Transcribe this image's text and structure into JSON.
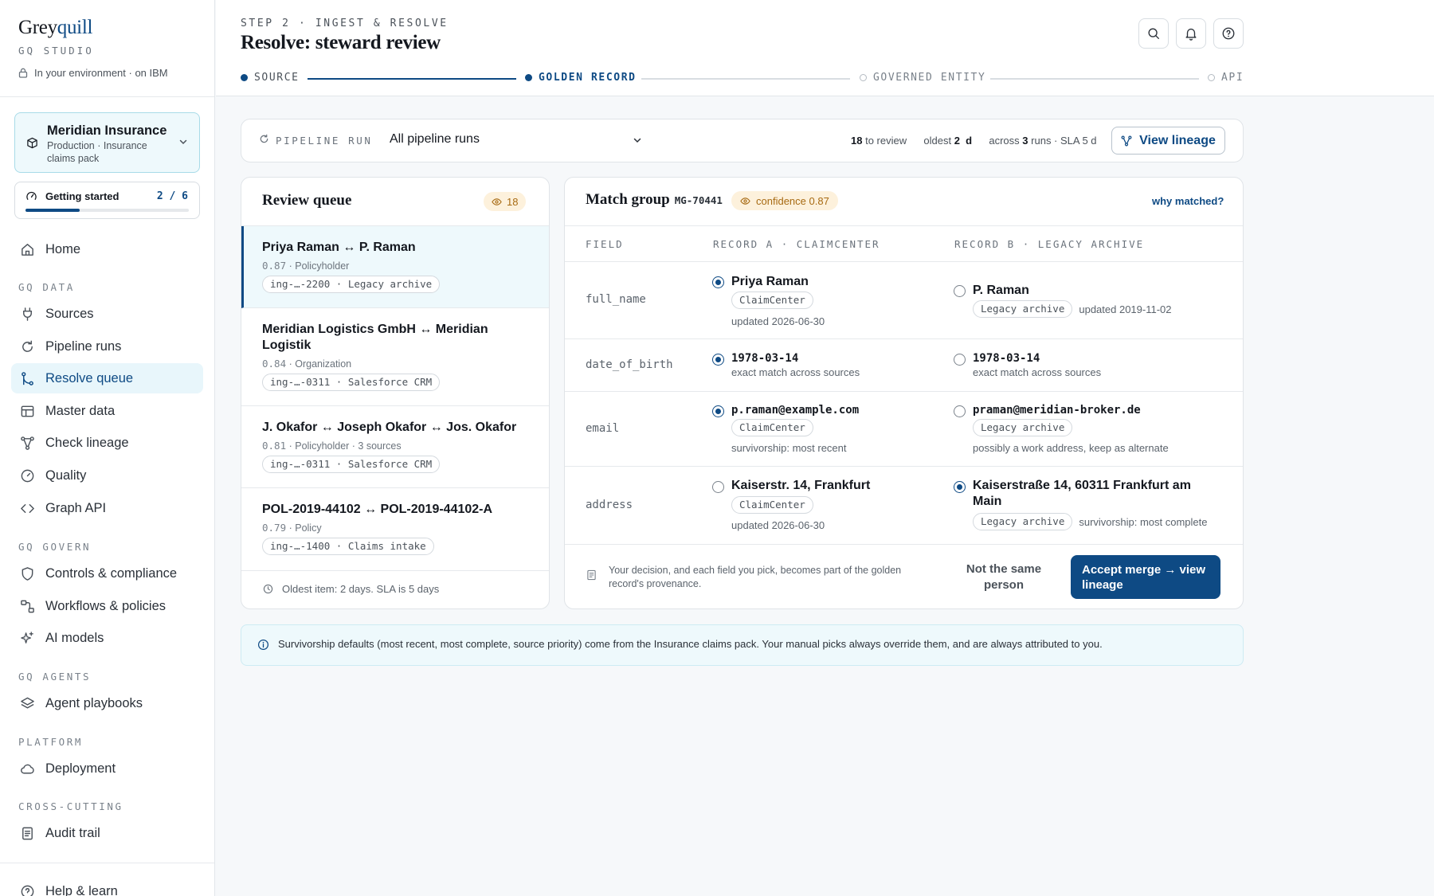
{
  "brand": {
    "name_a": "Grey",
    "name_b": "quill",
    "studio": "GQ STUDIO",
    "env": "In your environment · on IBM"
  },
  "workspace": {
    "name": "Meridian Insurance",
    "sub": "Production · Insurance claims pack"
  },
  "getting_started": {
    "label": "Getting started",
    "count": "2 / 6",
    "progress": 0.333
  },
  "nav": {
    "home": "Home",
    "sec_data": "GQ DATA",
    "sources": "Sources",
    "pipeline_runs": "Pipeline runs",
    "resolve_queue": "Resolve queue",
    "master_data": "Master data",
    "check_lineage": "Check lineage",
    "quality": "Quality",
    "graph_api": "Graph API",
    "sec_govern": "GQ GOVERN",
    "controls": "Controls & compliance",
    "workflows": "Workflows & policies",
    "ai_models": "AI models",
    "sec_agents": "GQ AGENTS",
    "agent_playbooks": "Agent playbooks",
    "sec_platform": "PLATFORM",
    "deployment": "Deployment",
    "sec_cross": "CROSS-CUTTING",
    "audit_trail": "Audit trail",
    "help": "Help & learn"
  },
  "header": {
    "kicker": "STEP 2 · INGEST & RESOLVE",
    "title": "Resolve: steward review",
    "steps": [
      "SOURCE",
      "GOLDEN RECORD",
      "GOVERNED ENTITY",
      "API"
    ]
  },
  "filter": {
    "label": "PIPELINE RUN",
    "value": "All pipeline runs",
    "to_review_num": "18",
    "to_review_txt": "to review",
    "oldest_txt": "oldest",
    "oldest_num": "2",
    "oldest_unit": "d",
    "across_txt": "across",
    "runs_num": "3",
    "runs_txt": "runs · SLA 5 d",
    "lineage_button": "View lineage"
  },
  "queue": {
    "title": "Review queue",
    "count": "18",
    "items": [
      {
        "title": "Priya Raman ↔ P. Raman",
        "score": "0.87",
        "meta": "· Policyholder",
        "pill": "ing-…-2200 · Legacy archive"
      },
      {
        "title": "Meridian Logistics GmbH ↔ Meridian Logistik",
        "score": "0.84",
        "meta": "· Organization",
        "pill": "ing-…-0311 · Salesforce CRM"
      },
      {
        "title": "J. Okafor ↔ Joseph Okafor ↔ Jos. Okafor",
        "score": "0.81",
        "meta": "· Policyholder · 3 sources",
        "pill": "ing-…-0311 · Salesforce CRM"
      },
      {
        "title": "POL-2019-44102 ↔ POL-2019-44102-A",
        "score": "0.79",
        "meta": "· Policy",
        "pill": "ing-…-1400 · Claims intake"
      }
    ],
    "footer": "Oldest item: 2 days. SLA is 5 days"
  },
  "match": {
    "title": "Match group",
    "id": "MG-70441",
    "confidence": "confidence 0.87",
    "why": "why matched?",
    "col_field": "FIELD",
    "col_a": "RECORD A · CLAIMCENTER",
    "col_b": "RECORD B · LEGACY ARCHIVE",
    "rows": [
      {
        "field": "full_name",
        "a_value": "Priya Raman",
        "a_pill": "ClaimCenter",
        "a_sub": "updated 2026-06-30",
        "b_value": "P. Raman",
        "b_pill": "Legacy archive",
        "b_sub": "updated 2019-11-02",
        "selected": "a"
      },
      {
        "field": "date_of_birth",
        "a_value": "1978-03-14",
        "a_sub": "exact match across sources",
        "b_value": "1978-03-14",
        "b_sub": "exact match across sources",
        "selected": "a"
      },
      {
        "field": "email",
        "a_value": "p.raman@example.com",
        "a_pill": "ClaimCenter",
        "a_sub": "survivorship: most recent",
        "b_value": "praman@meridian-broker.de",
        "b_pill": "Legacy archive",
        "b_sub": "possibly a work address, keep as alternate",
        "selected": "a"
      },
      {
        "field": "address",
        "a_value": "Kaiserstr. 14, Frankfurt",
        "a_pill": "ClaimCenter",
        "a_sub": "updated 2026-06-30",
        "b_value": "Kaiserstraße 14, 60311 Frankfurt am Main",
        "b_pill": "Legacy archive",
        "b_sub": "survivorship: most complete",
        "selected": "b"
      }
    ],
    "note": "Your decision, and each field you pick, becomes part of the golden record's provenance.",
    "reject": "Not the same person",
    "accept": "Accept merge → view lineage"
  },
  "info": "Survivorship defaults (most recent, most complete, source priority) come from the Insurance claims pack. Your manual picks always override them, and are always attributed to you.",
  "colors": {
    "accent": "#0e4a84",
    "active_bg": "#e8f6fb",
    "badge_bg": "#fdf1dc",
    "badge_fg": "#a76a12"
  }
}
